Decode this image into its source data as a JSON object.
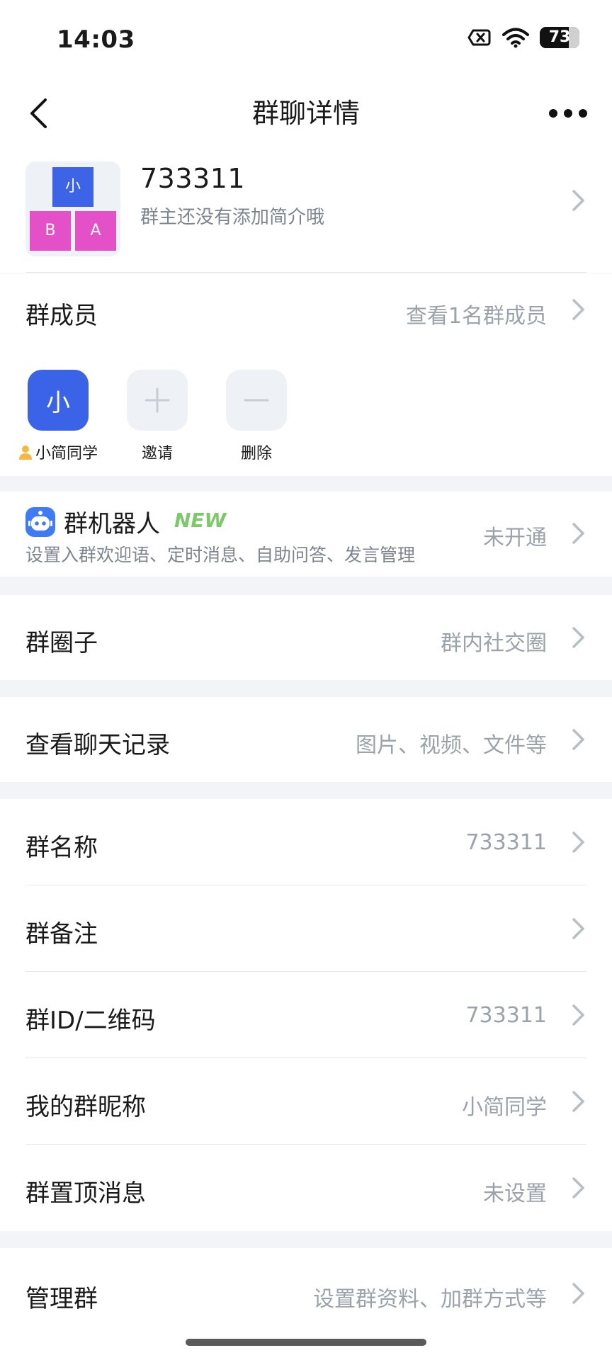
{
  "status_bar": {
    "time": "14:03",
    "battery": "73",
    "battery_level": 0.73
  },
  "nav": {
    "title": "群聊详情"
  },
  "group": {
    "name": "733311",
    "intro": "群主还没有添加简介哦",
    "avatar_cells": [
      {
        "text": "小",
        "color": "#3d63e6"
      },
      {
        "text": "B",
        "color": "#e350c8"
      },
      {
        "text": "A",
        "color": "#e350c8"
      }
    ]
  },
  "members": {
    "title": "群成员",
    "view_all": "查看1名群成员",
    "items": [
      {
        "avatar_text": "小",
        "label": "小简同学",
        "owner_icon": "person-icon"
      },
      {
        "label": "邀请",
        "icon": "plus-icon"
      },
      {
        "label": "删除",
        "icon": "minus-icon"
      }
    ]
  },
  "bot": {
    "title": "群机器人",
    "badge": "NEW",
    "desc": "设置入群欢迎语、定时消息、自助问答、发言管理",
    "status": "未开通"
  },
  "circle": {
    "label": "群圈子",
    "value": "群内社交圈"
  },
  "history": {
    "label": "查看聊天记录",
    "value": "图片、视频、文件等"
  },
  "settings": [
    {
      "label": "群名称",
      "value": "733311"
    },
    {
      "label": "群备注",
      "value": ""
    },
    {
      "label": "群ID/二维码",
      "value": "733311"
    },
    {
      "label": "我的群昵称",
      "value": "小简同学"
    },
    {
      "label": "群置顶消息",
      "value": "未设置"
    }
  ],
  "manage": {
    "label": "管理群",
    "value": "设置群资料、加群方式等"
  },
  "colors": {
    "accent": "#3a63e8",
    "new_badge": "#7dc96a",
    "secondary_text": "#9aa2ab",
    "section_gap": "#f2f4f7",
    "avatar_pink": "#e350c8"
  }
}
